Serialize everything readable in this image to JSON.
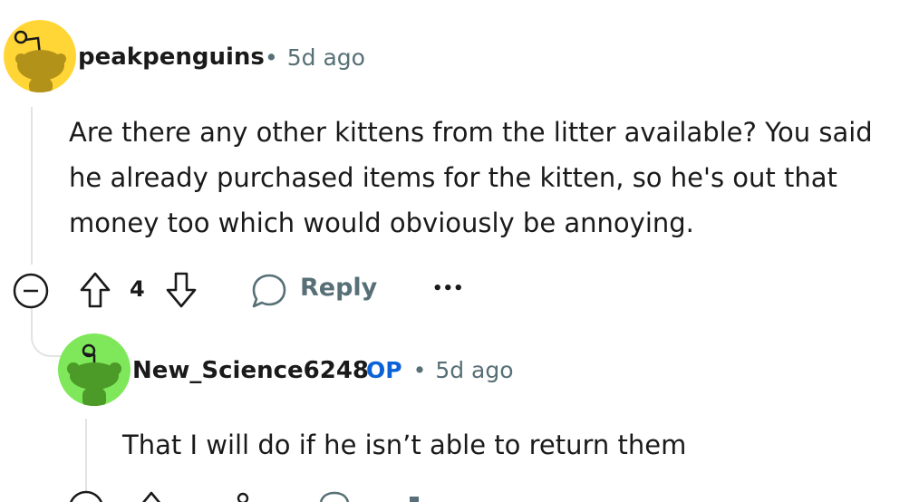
{
  "comments": [
    {
      "username": "peakpenguins",
      "op_badge": "",
      "separator": "•",
      "timestamp": "5d ago",
      "avatar_icon": "snoo-avatar-yellow",
      "avatar_color": "#ffd635",
      "body_lines": [
        "Are there any other kittens from the litter available? You said",
        "he already purchased items for the kitten, so he's out that",
        "money too which would obviously be annoying."
      ],
      "upvotes": "4",
      "reply_label": "Reply",
      "more_label": "•••"
    },
    {
      "username": "New_Science6248",
      "op_badge": "OP",
      "separator": "•",
      "timestamp": "5d ago",
      "avatar_icon": "snoo-avatar-green",
      "avatar_color": "#7ee85a",
      "body_lines": [
        "That I will do if he isn’t able to return them"
      ]
    }
  ],
  "colors": {
    "text": "#1a1a1b",
    "meta": "#576f76",
    "op": "#0b62d6",
    "thread_line": "#e1e3e5"
  }
}
